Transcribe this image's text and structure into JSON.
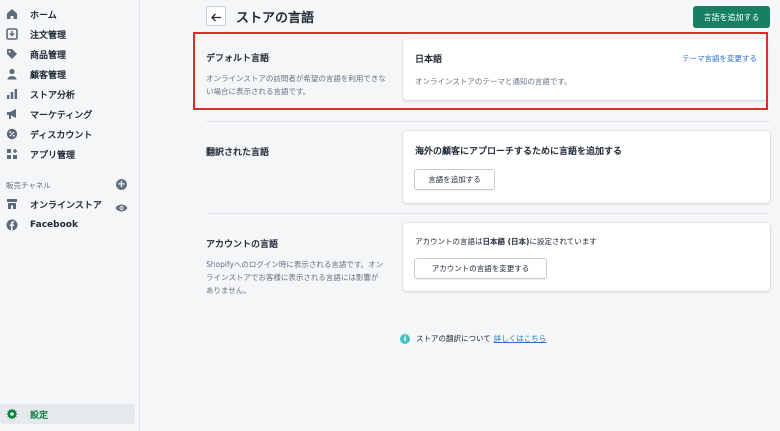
{
  "sidebar": {
    "items": [
      {
        "label": "ホーム",
        "icon": "home-icon"
      },
      {
        "label": "注文管理",
        "icon": "orders-icon"
      },
      {
        "label": "商品管理",
        "icon": "tag-icon"
      },
      {
        "label": "顧客管理",
        "icon": "person-icon"
      },
      {
        "label": "ストア分析",
        "icon": "bar-chart-icon"
      },
      {
        "label": "マーケティング",
        "icon": "megaphone-icon"
      },
      {
        "label": "ディスカウント",
        "icon": "discount-icon"
      },
      {
        "label": "アプリ管理",
        "icon": "apps-icon"
      }
    ],
    "sales_channels_label": "販売チャネル",
    "channels": [
      {
        "label": "オンラインストア",
        "icon": "store-icon"
      },
      {
        "label": "Facebook",
        "icon": "facebook-icon"
      }
    ],
    "settings_label": "設定"
  },
  "header": {
    "title": "ストアの言語",
    "add_language_button": "言語を追加する"
  },
  "default_language": {
    "section_title": "デフォルト言語",
    "section_desc": "オンラインストアの訪問者が希望の言語を利用できない場合に表示される言語です。",
    "language_name": "日本語",
    "change_theme_link": "テーマ言語を変更する",
    "card_desc": "オンラインストアのテーマと通知の言語です。"
  },
  "translated_languages": {
    "section_title": "翻訳された言語",
    "card_title": "海外の顧客にアプローチするために言語を追加する",
    "add_button": "言語を追加する"
  },
  "account_language": {
    "section_title": "アカウントの言語",
    "section_desc": "Shopifyへのログイン時に表示される言語です。オンラインストアでお客様に表示される言語には影響がありません。",
    "text_prefix": "アカウントの言語は",
    "text_value": "日本語 (日本)",
    "text_suffix": "に設定されています",
    "change_button": "アカウントの言語を変更する"
  },
  "footer": {
    "text": "ストアの翻訳について",
    "link": "詳しくはこちら"
  },
  "colors": {
    "primary": "#168060",
    "link": "#2c6ecb",
    "highlight": "#e52a2a"
  }
}
